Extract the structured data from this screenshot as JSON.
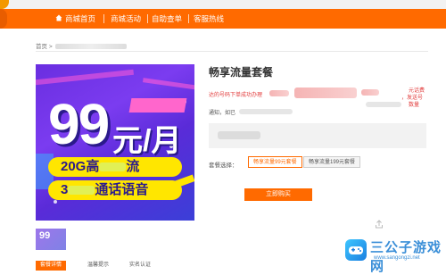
{
  "nav": {
    "items": [
      "商城首页",
      "商城活动",
      "自助查单",
      "客服热线"
    ],
    "accent": "#ff6a00"
  },
  "breadcrumb": {
    "home": "首页",
    "sep": ">"
  },
  "product_image": {
    "price_big": "99",
    "price_unit": "元/月",
    "line1_prefix": "20G高",
    "line1_suffix": "流",
    "line2_prefix": "3",
    "line2_suffix": "通话语音"
  },
  "thumbnail": {
    "text": "99"
  },
  "tabs": {
    "active": "套餐详情",
    "items": [
      "温馨提示",
      "实名认证"
    ]
  },
  "product": {
    "title": "畅享流量套餐",
    "notice_red": "达的号码下单成功办理",
    "notice_red_tail": "元话费",
    "notice_red_tail2": "，发送号",
    "notice_red_tail3": "数量",
    "notice_grey": "通知，如已",
    "package_label": "套餐选择：",
    "packages": [
      "畅享流量99元套餐",
      "畅享流量199元套餐"
    ],
    "selected_package": "畅享流量99元套餐",
    "buy_label": "立即购买"
  },
  "watermark": {
    "title": "三公子游戏网",
    "url": "www.sangongzi.net"
  },
  "icons": {
    "home": "home-icon",
    "share": "share-icon",
    "logo": "site-logo-icon"
  }
}
